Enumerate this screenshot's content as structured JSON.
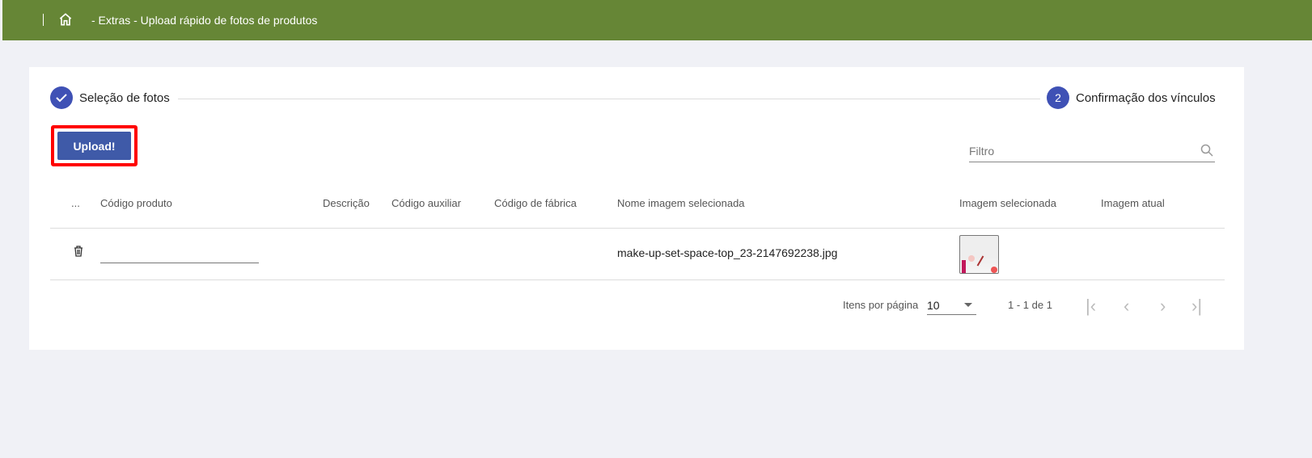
{
  "header": {
    "breadcrumb": "- Extras - Upload rápido de fotos de produtos"
  },
  "stepper": {
    "steps": [
      {
        "label": "Seleção de fotos",
        "state": "done"
      },
      {
        "number": "2",
        "label": "Confirmação dos vínculos",
        "state": "active"
      }
    ]
  },
  "toolbar": {
    "upload_label": "Upload!",
    "filter_placeholder": "Filtro"
  },
  "table": {
    "columns": [
      "...",
      "Código produto",
      "Descrição",
      "Código auxiliar",
      "Código de fábrica",
      "Nome imagem selecionada",
      "Imagem selecionada",
      "Imagem atual"
    ],
    "rows": [
      {
        "codigo_produto": "",
        "descricao": "",
        "codigo_auxiliar": "",
        "codigo_fabrica": "",
        "nome_imagem": "make-up-set-space-top_23-2147692238.jpg"
      }
    ]
  },
  "pagination": {
    "items_label": "Itens por página",
    "page_size": "10",
    "range": "1 - 1 de 1"
  },
  "colors": {
    "header": "#668636",
    "primary": "#3f51b5",
    "highlight": "#ff0000"
  }
}
